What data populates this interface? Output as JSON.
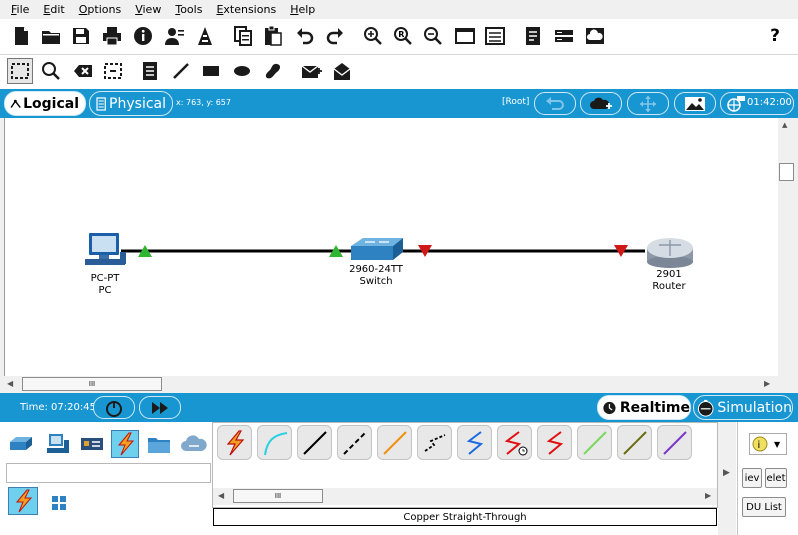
{
  "menu": [
    "File",
    "Edit",
    "Options",
    "View",
    "Tools",
    "Extensions",
    "Help"
  ],
  "menu_underline": [
    "F",
    "E",
    "O",
    "V",
    "T",
    "E",
    "H"
  ],
  "toolbar1": {
    "icons": [
      "new-file-icon",
      "open-folder-icon",
      "save-icon",
      "print-icon",
      "info-icon",
      "user-icon",
      "wizard-icon",
      "copy-icon",
      "paste-icon",
      "undo-icon",
      "redo-icon",
      "zoom-in-icon",
      "zoom-reset-icon",
      "zoom-out-icon",
      "window-icon",
      "list-icon",
      "document-icon",
      "server-icon",
      "cloud-window-icon"
    ],
    "help_label": "?"
  },
  "toolbar2": {
    "icons": [
      "select-icon",
      "inspect-icon",
      "delete-icon",
      "resize-icon",
      "note-icon",
      "line-draw-icon",
      "rectangle-icon",
      "ellipse-icon",
      "freeform-icon",
      "simple-pdu-icon",
      "complex-pdu-icon"
    ]
  },
  "modebar": {
    "logical_label": "Logical",
    "physical_label": "Physical",
    "coord": "x: 763, y: 657",
    "root_label": "[Root]",
    "clock": "01:42:00"
  },
  "devices": [
    {
      "model": "PC-PT",
      "name": "PC"
    },
    {
      "model": "2960-24TT",
      "name": "Switch"
    },
    {
      "model": "2901",
      "name": "Router"
    }
  ],
  "hscroll_grip": "III",
  "timebar": {
    "time": "Time: 07:20:45",
    "realtime_label": "Realtime",
    "simulation_label": "Simulation"
  },
  "connections_label": "Copper Straight-Through",
  "lower_grip": "III",
  "side_buttons": [
    "iev",
    "elet",
    "DU List"
  ],
  "colors": {
    "accent_blue": "#1896d2",
    "link_up": "#2fb52f",
    "link_down": "#d01818"
  }
}
